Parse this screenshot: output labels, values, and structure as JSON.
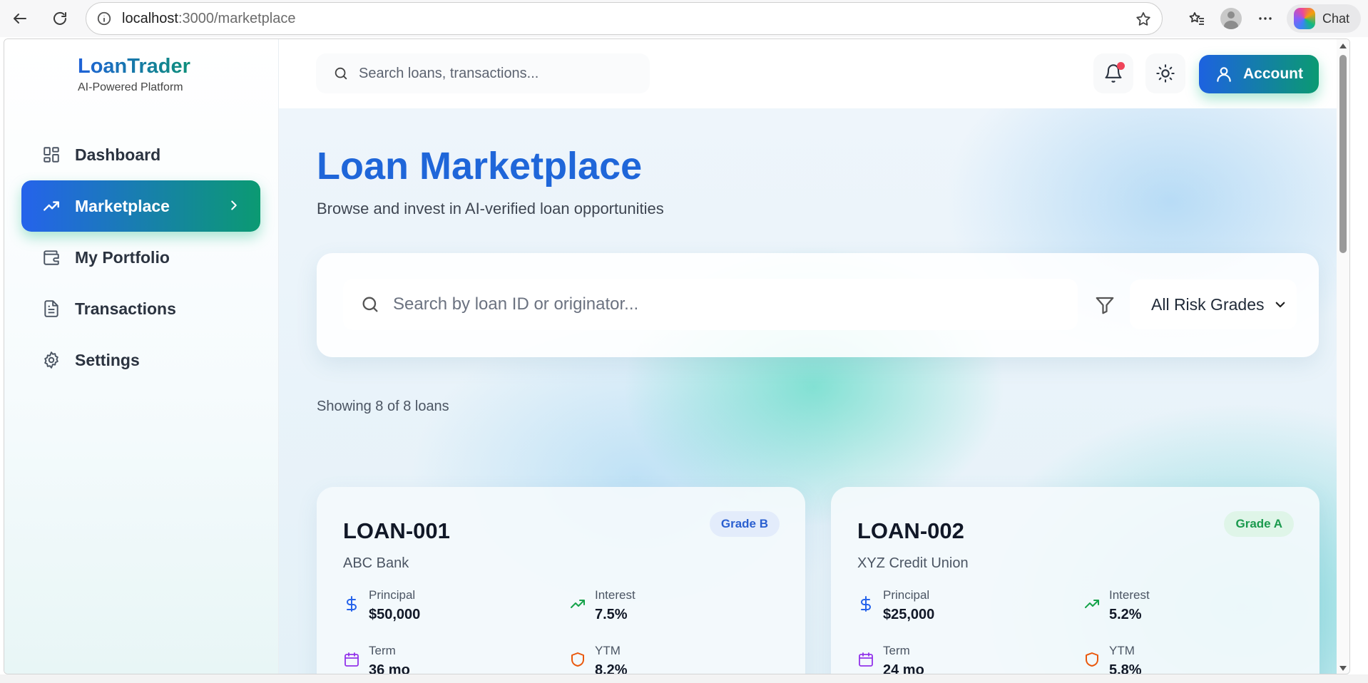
{
  "browser": {
    "url_host": "localhost",
    "url_path": ":3000/marketplace",
    "chat_label": "Chat"
  },
  "brand": {
    "name": "LoanTrader",
    "tagline": "AI-Powered Platform"
  },
  "sidebar": {
    "items": [
      {
        "label": "Dashboard",
        "icon": "grid-icon"
      },
      {
        "label": "Marketplace",
        "icon": "trending-up-icon",
        "active": true
      },
      {
        "label": "My Portfolio",
        "icon": "wallet-icon"
      },
      {
        "label": "Transactions",
        "icon": "document-icon"
      },
      {
        "label": "Settings",
        "icon": "gear-icon"
      }
    ]
  },
  "header": {
    "search_placeholder": "Search loans, transactions...",
    "account_label": "Account",
    "has_notifications": true
  },
  "main": {
    "title": "Loan Marketplace",
    "subtitle": "Browse and invest in AI-verified loan opportunities",
    "search_placeholder": "Search by loan ID or originator...",
    "risk_filter": "All Risk Grades",
    "count_text": "Showing 8 of 8 loans"
  },
  "loans": [
    {
      "id": "LOAN-001",
      "originator": "ABC Bank",
      "grade": "Grade B",
      "principal_label": "Principal",
      "principal": "$50,000",
      "interest_label": "Interest",
      "interest": "7.5%",
      "term_label": "Term",
      "term": "36 mo",
      "ytm_label": "YTM",
      "ytm": "8.2%"
    },
    {
      "id": "LOAN-002",
      "originator": "XYZ Credit Union",
      "grade": "Grade A",
      "principal_label": "Principal",
      "principal": "$25,000",
      "interest_label": "Interest",
      "interest": "5.2%",
      "term_label": "Term",
      "term": "24 mo",
      "ytm_label": "YTM",
      "ytm": "5.8%"
    }
  ],
  "colors": {
    "accent_blue": "#1f66d9",
    "accent_green": "#0b9a72",
    "notification_dot": "#ef4459",
    "grade_a": "#1b9a4e",
    "grade_b": "#2a5fd0"
  }
}
